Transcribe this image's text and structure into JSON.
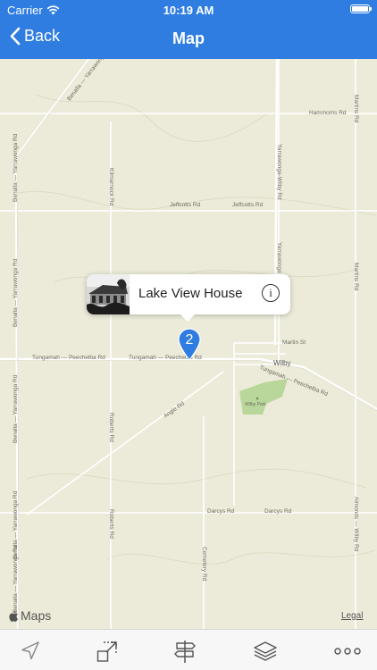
{
  "status_bar": {
    "carrier": "Carrier",
    "time": "10:19 AM",
    "battery_level": 1.0
  },
  "nav": {
    "back_label": "Back",
    "title": "Map"
  },
  "map": {
    "road_labels": {
      "benalla_yarrawonga_1": "Benalla — Yarrawonga Rd",
      "benalla_yarrawonga_2": "Benalla — Yarrawonga Rd",
      "benalla_yarrawonga_3": "Benalla — Yarrawonga Rd",
      "benalla_yarrawonga_4": "Benalla — Yarrawonga Rd",
      "benalla_yarrawonga_5": "Benalla — Yarrawonga Rd",
      "benalla_yarrawonga_top": "Benalla — Yarrawonga",
      "hammoms": "Hammoms Rd",
      "martins_1": "Martins Rd",
      "martins_2": "Martins Rd",
      "jeffcotts_1": "Jeffcotts Rd",
      "jeffcotts_2": "Jeffcotts Rd",
      "kilmarnock": "Kilmarnock Rd",
      "yarrawonga_wilby": "Yarrawonga-Wilby Rd",
      "yarrawonga_2": "Yarrawonga",
      "martin_st": "Martin St",
      "tungamah_peechelba_1": "Tungamah — Peechelba Rd",
      "tungamah_peechelba_2": "Tungamah — Peechelba Rd",
      "tungamah_peechelba_3": "Tungamah — Peechelba Rd",
      "wilby": "Wilby",
      "wilby_park": "Wilby Park",
      "angle": "Angle Rd",
      "roberts_1": "Roberts Rd",
      "roberts_2": "Roberts Rd",
      "darcys_1": "Darcys Rd",
      "darcys_2": "Darcys Rd",
      "cemetery": "Cemetery Rd",
      "almonds_wilby": "Almonds — Wilby Rd"
    },
    "callout": {
      "title": "Lake View House",
      "info_icon": "info-icon"
    },
    "marker": {
      "count": "2",
      "color": "#2f7de1"
    },
    "attribution": {
      "maps_logo": "Maps",
      "legal": "Legal"
    }
  },
  "toolbar": {
    "items": [
      {
        "icon": "location-arrow-icon"
      },
      {
        "icon": "expand-icon"
      },
      {
        "icon": "signpost-icon"
      },
      {
        "icon": "layers-icon"
      },
      {
        "icon": "more-icon"
      }
    ]
  },
  "colors": {
    "nav_bar": "#2f7de1",
    "map_background": "#ecebd9",
    "park": "#b9d79a"
  }
}
